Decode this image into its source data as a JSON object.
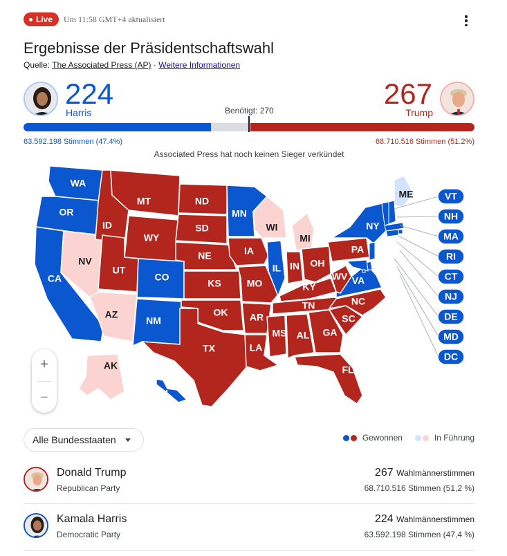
{
  "header": {
    "live_label": "Live",
    "updated": "Um 11:58 GMT+4 aktualisiert",
    "title": "Ergebnisse der Präsidentschaftswahl",
    "source_prefix": "Quelle:",
    "source_link": "The Associated Press (AP)",
    "separator": "·",
    "more_link": "Weitere Informationen"
  },
  "tally": {
    "harris": {
      "name": "Harris",
      "electoral_votes": "224",
      "popular": "63.592.198 Stimmen (47.4%)",
      "ev_fraction": 0.4164
    },
    "trump": {
      "name": "Trump",
      "electoral_votes": "267",
      "popular": "68.710.516 Stimmen (51.2%)",
      "ev_fraction": 0.4963
    },
    "needed": "Benötigt: 270",
    "status": "Associated Press hat noch keinen Sieger verkündet"
  },
  "colors": {
    "dem": "#0b57d0",
    "rep": "#b3261e",
    "dem_lead": "#d3e3fd",
    "rep_lead": "#fbd3d0"
  },
  "map": {
    "states": [
      {
        "code": "WA",
        "status": "dem"
      },
      {
        "code": "OR",
        "status": "dem"
      },
      {
        "code": "CA",
        "status": "dem"
      },
      {
        "code": "NV",
        "status": "rep_lead"
      },
      {
        "code": "ID",
        "status": "rep"
      },
      {
        "code": "MT",
        "status": "rep"
      },
      {
        "code": "WY",
        "status": "rep"
      },
      {
        "code": "UT",
        "status": "rep"
      },
      {
        "code": "AZ",
        "status": "rep_lead"
      },
      {
        "code": "CO",
        "status": "dem"
      },
      {
        "code": "NM",
        "status": "dem"
      },
      {
        "code": "ND",
        "status": "rep"
      },
      {
        "code": "SD",
        "status": "rep"
      },
      {
        "code": "NE",
        "status": "rep"
      },
      {
        "code": "KS",
        "status": "rep"
      },
      {
        "code": "OK",
        "status": "rep"
      },
      {
        "code": "TX",
        "status": "rep"
      },
      {
        "code": "MN",
        "status": "dem"
      },
      {
        "code": "IA",
        "status": "rep"
      },
      {
        "code": "MO",
        "status": "rep"
      },
      {
        "code": "AR",
        "status": "rep"
      },
      {
        "code": "LA",
        "status": "rep"
      },
      {
        "code": "WI",
        "status": "rep_lead"
      },
      {
        "code": "IL",
        "status": "dem"
      },
      {
        "code": "MI",
        "status": "rep_lead"
      },
      {
        "code": "IN",
        "status": "rep"
      },
      {
        "code": "OH",
        "status": "rep"
      },
      {
        "code": "KY",
        "status": "rep"
      },
      {
        "code": "TN",
        "status": "rep"
      },
      {
        "code": "MS",
        "status": "rep"
      },
      {
        "code": "AL",
        "status": "rep"
      },
      {
        "code": "GA",
        "status": "rep"
      },
      {
        "code": "FL",
        "status": "rep"
      },
      {
        "code": "SC",
        "status": "rep"
      },
      {
        "code": "NC",
        "status": "rep"
      },
      {
        "code": "VA",
        "status": "dem"
      },
      {
        "code": "WV",
        "status": "rep"
      },
      {
        "code": "PA",
        "status": "rep"
      },
      {
        "code": "NY",
        "status": "dem"
      },
      {
        "code": "ME",
        "status": "dem_lead"
      },
      {
        "code": "AK",
        "status": "rep_lead"
      },
      {
        "code": "HI",
        "status": "dem"
      }
    ],
    "small_states": [
      "VT",
      "NH",
      "MA",
      "RI",
      "CT",
      "NJ",
      "DE",
      "MD",
      "DC"
    ]
  },
  "controls": {
    "zoom_in": "+",
    "zoom_out": "−",
    "filter": "Alle Bundesstaaten",
    "legend_won": "Gewonnen",
    "legend_lead": "In Führung"
  },
  "candidates": [
    {
      "name": "Donald Trump",
      "party": "Republican Party",
      "ev": "267",
      "ev_label": "Wahlmännerstimmen",
      "popular": "68.710.516 Stimmen (51,2 %)"
    },
    {
      "name": "Kamala Harris",
      "party": "Democratic Party",
      "ev": "224",
      "ev_label": "Wahlmännerstimmen",
      "popular": "63.592.198 Stimmen (47,4 %)"
    }
  ]
}
